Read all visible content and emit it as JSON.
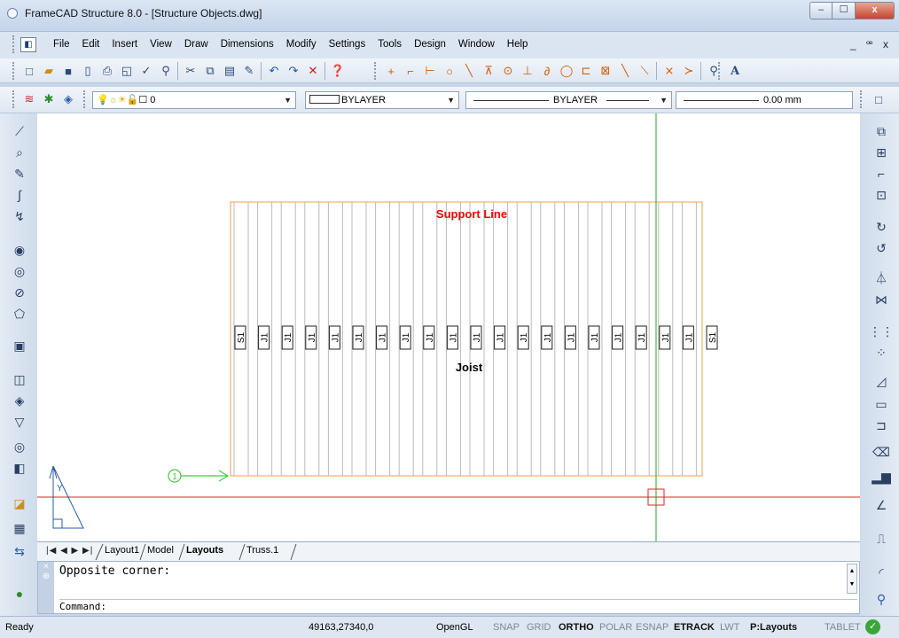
{
  "window": {
    "title": "FrameCAD Structure 8.0 - [Structure Objects.dwg]",
    "controls": {
      "minimize": "‒",
      "maximize": "☐",
      "close": "x"
    }
  },
  "menu": {
    "items": [
      "File",
      "Edit",
      "Insert",
      "View",
      "Draw",
      "Dimensions",
      "Modify",
      "Settings",
      "Tools",
      "Design",
      "Window",
      "Help"
    ],
    "mdi_controls": "_ ꟹ x"
  },
  "properties_bar": {
    "layer_value": "0",
    "color_value": "BYLAYER",
    "linetype_value": "BYLAYER",
    "lineweight_value": "0.00 mm"
  },
  "drawing": {
    "support_label": "Support Line",
    "joist_label": "Joist",
    "member_labels": [
      "S1",
      "J1",
      "J1",
      "J1",
      "J1",
      "J1",
      "J1",
      "J1",
      "J1",
      "J1",
      "J1",
      "J1",
      "J1",
      "J1",
      "J1",
      "J1",
      "J1",
      "J1",
      "J1",
      "J1",
      "S1"
    ],
    "gridline_marker": "1",
    "ucs_label": "Y",
    "colors": {
      "joist_outline": "#f0a040",
      "member_lines": "#bbbbbb",
      "support_text": "#ff0000",
      "crosshair_h": "#e02020",
      "crosshair_v": "#22aa22",
      "marker": "#44cc44"
    }
  },
  "layout_tabs": {
    "nav": "|◀ ◀ ▶ ▶|",
    "tabs": [
      {
        "label": "Layout1",
        "active": false
      },
      {
        "label": "Model",
        "active": false
      },
      {
        "label": "Layouts",
        "active": true
      },
      {
        "label": "Truss.1",
        "active": false
      }
    ]
  },
  "command": {
    "history": "Opposite corner:",
    "prompt": "Command:"
  },
  "status": {
    "state": "Ready",
    "coords": "49163,27340,0",
    "renderer": "OpenGL",
    "toggles": [
      {
        "label": "SNAP",
        "on": false
      },
      {
        "label": "GRID",
        "on": false
      },
      {
        "label": "ORTHO",
        "on": true
      },
      {
        "label": "POLAR",
        "on": false
      },
      {
        "label": "ESNAP",
        "on": false
      },
      {
        "label": "ETRACK",
        "on": true
      },
      {
        "label": "LWT",
        "on": false
      },
      {
        "label": "P:Layouts",
        "on": true
      }
    ],
    "tablet": "TABLET"
  }
}
